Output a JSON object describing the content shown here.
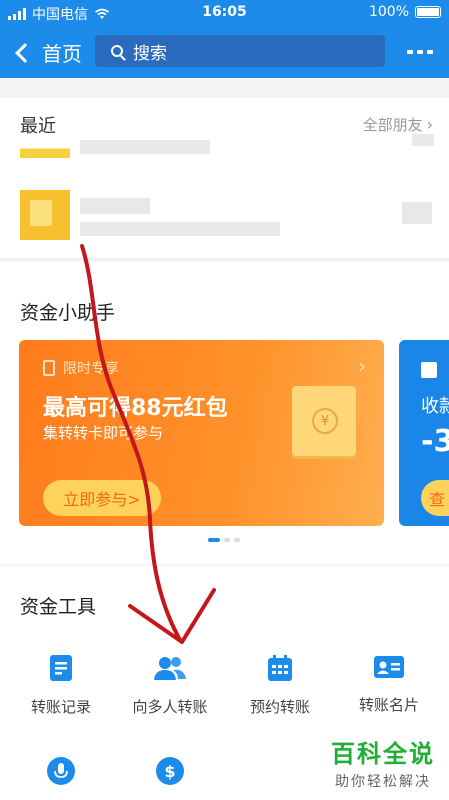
{
  "status_bar": {
    "carrier": "中国电信",
    "time": "16:05",
    "battery": "100%"
  },
  "nav": {
    "back_label": "首页",
    "search_placeholder": "搜索"
  },
  "recent": {
    "title": "最近",
    "all_friends": "全部朋友"
  },
  "fund_assistant": {
    "title": "资金小助手",
    "card": {
      "tag": "限时专享",
      "title": "最高可得88元红包",
      "subtitle": "集转转卡即可参与",
      "button": "立即参与>",
      "coin_symbol": "¥"
    },
    "card2": {
      "text": "收款",
      "big": "-3",
      "button": "查"
    },
    "page_count": 3,
    "active_page": 0
  },
  "fund_tools": {
    "title": "资金工具",
    "items": [
      {
        "label": "转账记录",
        "icon": "record-icon"
      },
      {
        "label": "向多人转账",
        "icon": "multi-user-icon"
      },
      {
        "label": "预约转账",
        "icon": "calendar-icon"
      },
      {
        "label": "转账名片",
        "icon": "card-icon"
      }
    ],
    "row2_icons": [
      "microphone-icon",
      "dollar-exchange-icon"
    ]
  },
  "watermark": {
    "title": "百科全说",
    "subtitle": "助你轻松解决"
  },
  "colors": {
    "brand_blue": "#1c8bea",
    "orange": "#ff7b1c",
    "annotation_red": "#c4161c",
    "watermark_green": "#1fae36"
  }
}
